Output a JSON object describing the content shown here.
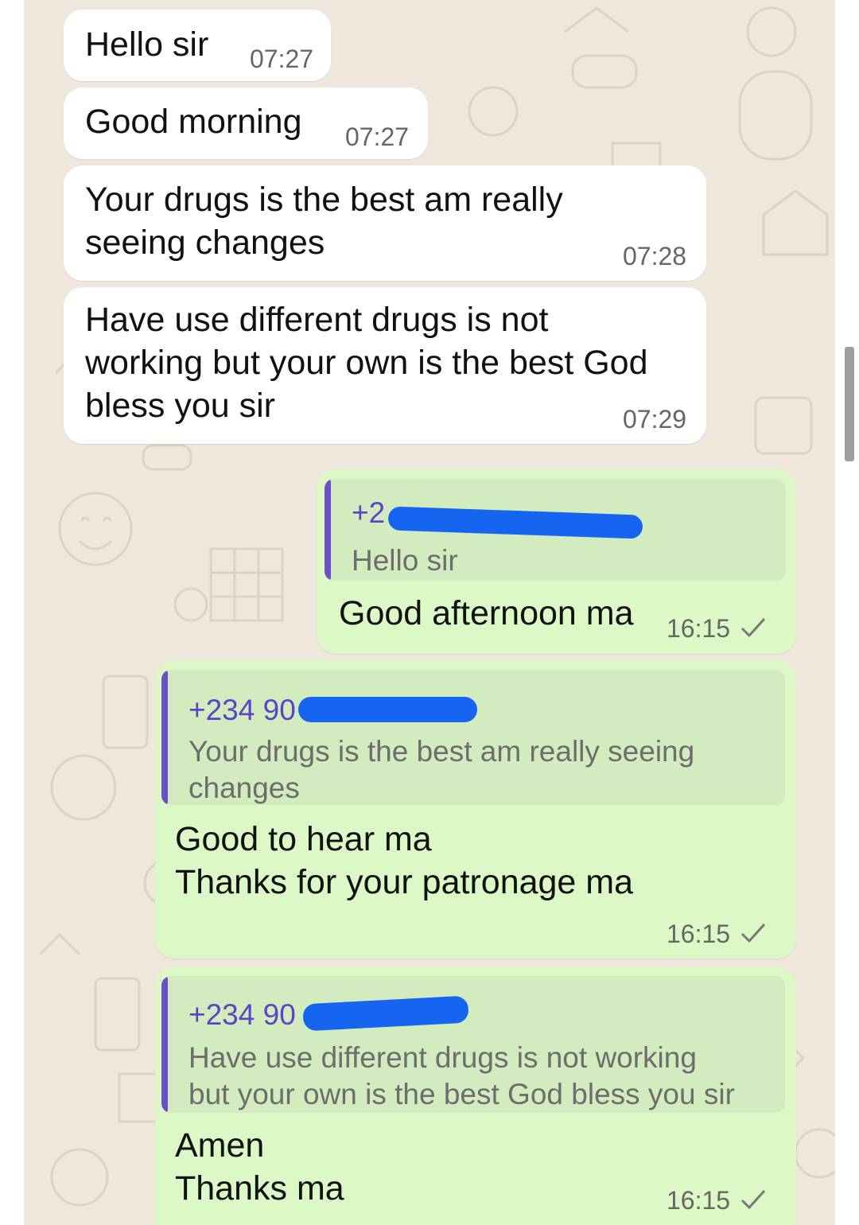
{
  "colors": {
    "incoming_bubble": "#ffffff",
    "outgoing_bubble": "#dcf8c6",
    "quote_bar": "#6b4fc9",
    "quote_name": "#5b45c4",
    "chat_background": "#efe7dc",
    "redaction": "#1565f0"
  },
  "incoming": [
    {
      "lines": [
        "Hello sir"
      ],
      "time": "07:27"
    },
    {
      "lines": [
        "Good morning"
      ],
      "time": "07:27"
    },
    {
      "lines": [
        "Your drugs is the best am really",
        "seeing changes"
      ],
      "time": "07:28"
    },
    {
      "lines": [
        "Have use different drugs is not",
        "working but your own is the best God",
        "bless you sir"
      ],
      "time": "07:29"
    }
  ],
  "outgoing": [
    {
      "quote_name": "+2",
      "quote_lines": [
        "Hello sir"
      ],
      "lines": [
        "Good afternoon ma"
      ],
      "time": "16:15",
      "status_icon": "check-icon"
    },
    {
      "quote_name": "+234 90",
      "quote_lines": [
        "Your drugs is the best am really seeing",
        "changes"
      ],
      "lines": [
        "Good to hear ma",
        "Thanks for your patronage ma"
      ],
      "time": "16:15",
      "status_icon": "check-icon"
    },
    {
      "quote_name": "+234 90",
      "quote_lines": [
        "Have use different drugs is not working",
        "but your own is the best God bless you sir"
      ],
      "lines": [
        "Amen",
        "Thanks ma"
      ],
      "time": "16:15",
      "status_icon": "check-icon"
    }
  ]
}
